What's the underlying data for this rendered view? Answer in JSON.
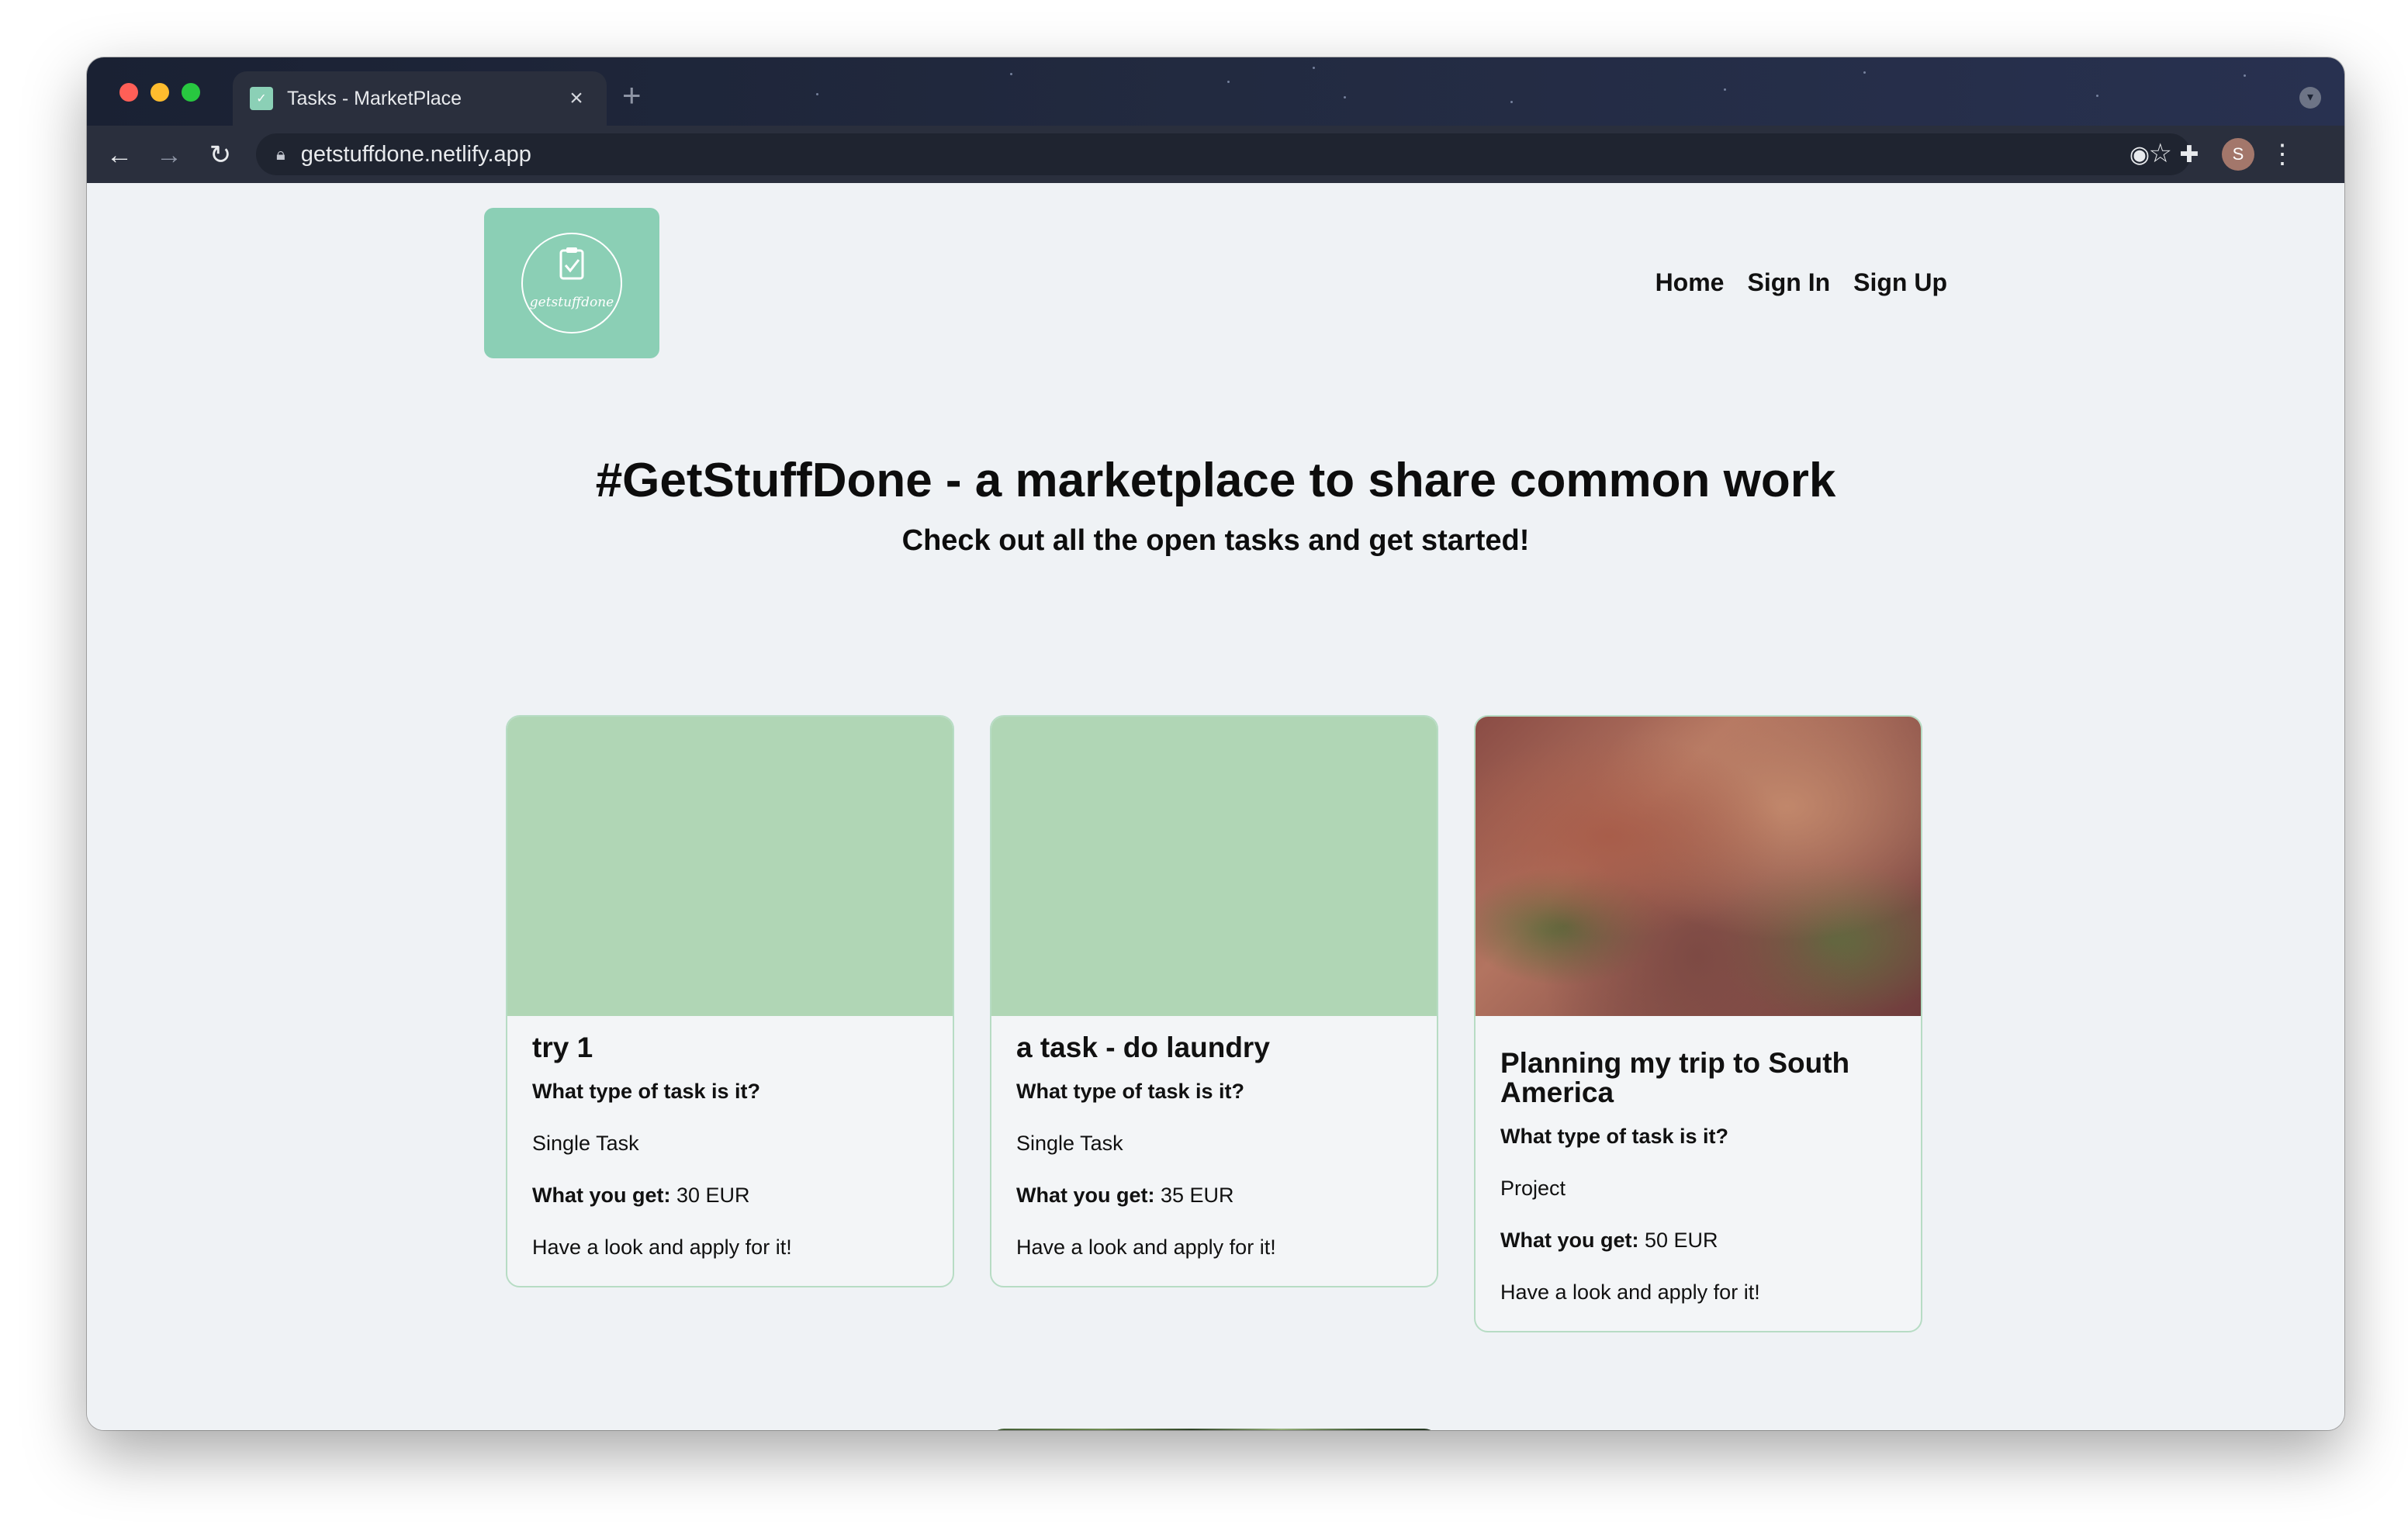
{
  "browser": {
    "tab_title": "Tasks - MarketPlace",
    "url": "getstuffdone.netlify.app",
    "profile_initial": "S",
    "icons": [
      "back-icon",
      "forward-icon",
      "reload-icon",
      "lock-icon",
      "bookmark-star-icon",
      "extension-icon",
      "puzzle-icon",
      "more-vert-icon",
      "close-icon",
      "new-tab-icon"
    ]
  },
  "header": {
    "logo_text": "getstuffdone",
    "nav": {
      "home": "Home",
      "sign_in": "Sign In",
      "sign_up": "Sign Up"
    }
  },
  "hero": {
    "title": "#GetStuffDone - a marketplace to share common work",
    "subtitle": "Check out all the open tasks and get started!"
  },
  "cards": [
    {
      "title": "try 1",
      "type_question": "What type of task is it?",
      "type": "Single Task",
      "pay_label": "What you get:",
      "pay_value": " 30 EUR",
      "cta": "Have a look and apply for it!"
    },
    {
      "title": "a task - do laundry",
      "type_question": "What type of task is it?",
      "type": "Single Task",
      "pay_label": "What you get:",
      "pay_value": " 35 EUR",
      "cta": "Have a look and apply for it!"
    },
    {
      "title": "Planning my trip to South America",
      "type_question": "What type of task is it?",
      "type": "Project",
      "pay_label": "What you get:",
      "pay_value": " 50 EUR",
      "cta": "Have a look and apply for it!"
    }
  ],
  "colors": {
    "logo_bg": "#8bcfb5",
    "placeholder_image": "#b0d6b5",
    "card_border": "#b7dcc4",
    "page_bg": "#eff2f5"
  }
}
